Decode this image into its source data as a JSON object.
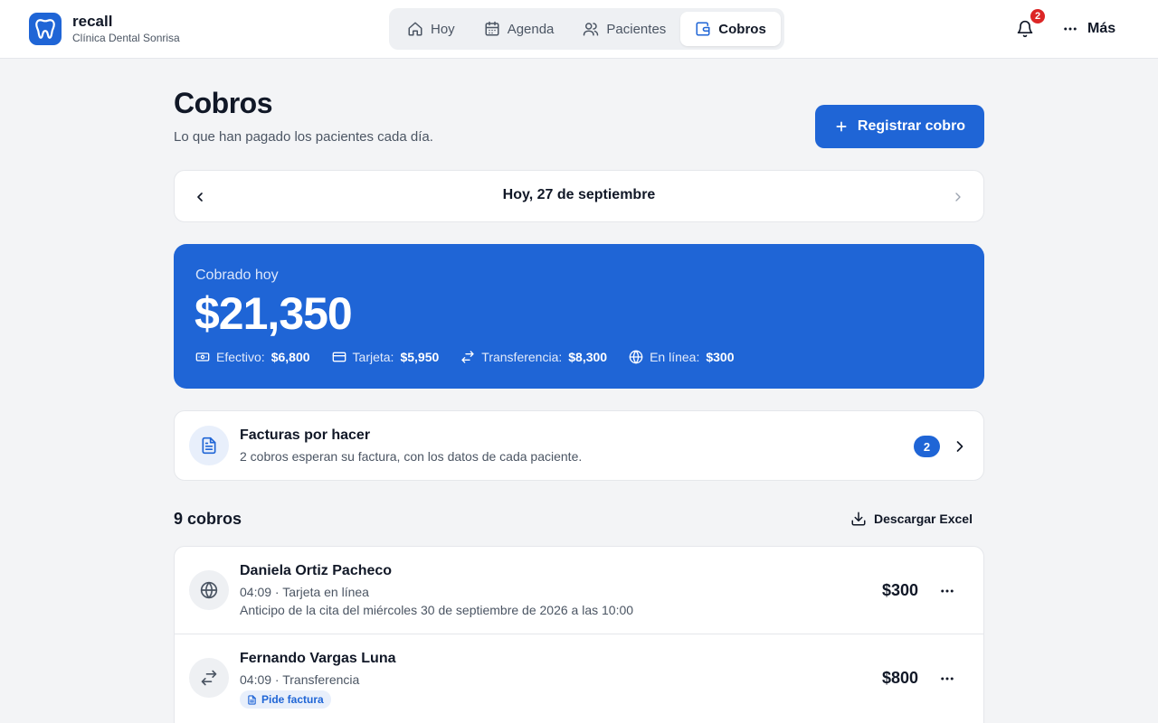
{
  "brand": {
    "name": "recall",
    "clinic": "Clínica Dental Sonrisa",
    "logo_icon": "tooth-icon"
  },
  "nav": {
    "tabs": [
      {
        "label": "Hoy",
        "icon": "home-icon",
        "active": false
      },
      {
        "label": "Agenda",
        "icon": "calendar-icon",
        "active": false
      },
      {
        "label": "Pacientes",
        "icon": "users-icon",
        "active": false
      },
      {
        "label": "Cobros",
        "icon": "wallet-icon",
        "active": true
      }
    ]
  },
  "header": {
    "notifications_count": "2",
    "more_label": "Más"
  },
  "page": {
    "title": "Cobros",
    "subtitle": "Lo que han pagado los pacientes cada día.",
    "register_button": "Registrar cobro"
  },
  "date_nav": {
    "label": "Hoy, 27 de septiembre"
  },
  "summary": {
    "label": "Cobrado hoy",
    "total": "$21,350",
    "methods": [
      {
        "icon": "cash-icon",
        "label": "Efectivo:",
        "value": "$6,800"
      },
      {
        "icon": "card-icon",
        "label": "Tarjeta:",
        "value": "$5,950"
      },
      {
        "icon": "transfer-icon",
        "label": "Transferencia:",
        "value": "$8,300"
      },
      {
        "icon": "globe-icon",
        "label": "En línea:",
        "value": "$300"
      }
    ]
  },
  "invoices": {
    "title": "Facturas por hacer",
    "subtitle": "2 cobros esperan su factura, con los datos de cada paciente.",
    "count": "2"
  },
  "payments": {
    "count_label": "9 cobros",
    "download_label": "Descargar Excel",
    "rows": [
      {
        "icon": "globe-icon",
        "name": "Daniela Ortiz Pacheco",
        "meta": "04:09 · Tarjeta en línea",
        "note": "Anticipo de la cita del miércoles 30 de septiembre de 2026 a las 10:00",
        "amount": "$300"
      },
      {
        "icon": "transfer-icon",
        "name": "Fernando Vargas Luna",
        "meta": "04:09 · Transferencia",
        "tag": "Pide factura",
        "amount": "$800"
      }
    ]
  },
  "colors": {
    "accent": "#1f65d6",
    "badge": "#dc2626",
    "background": "#f3f4f6"
  }
}
